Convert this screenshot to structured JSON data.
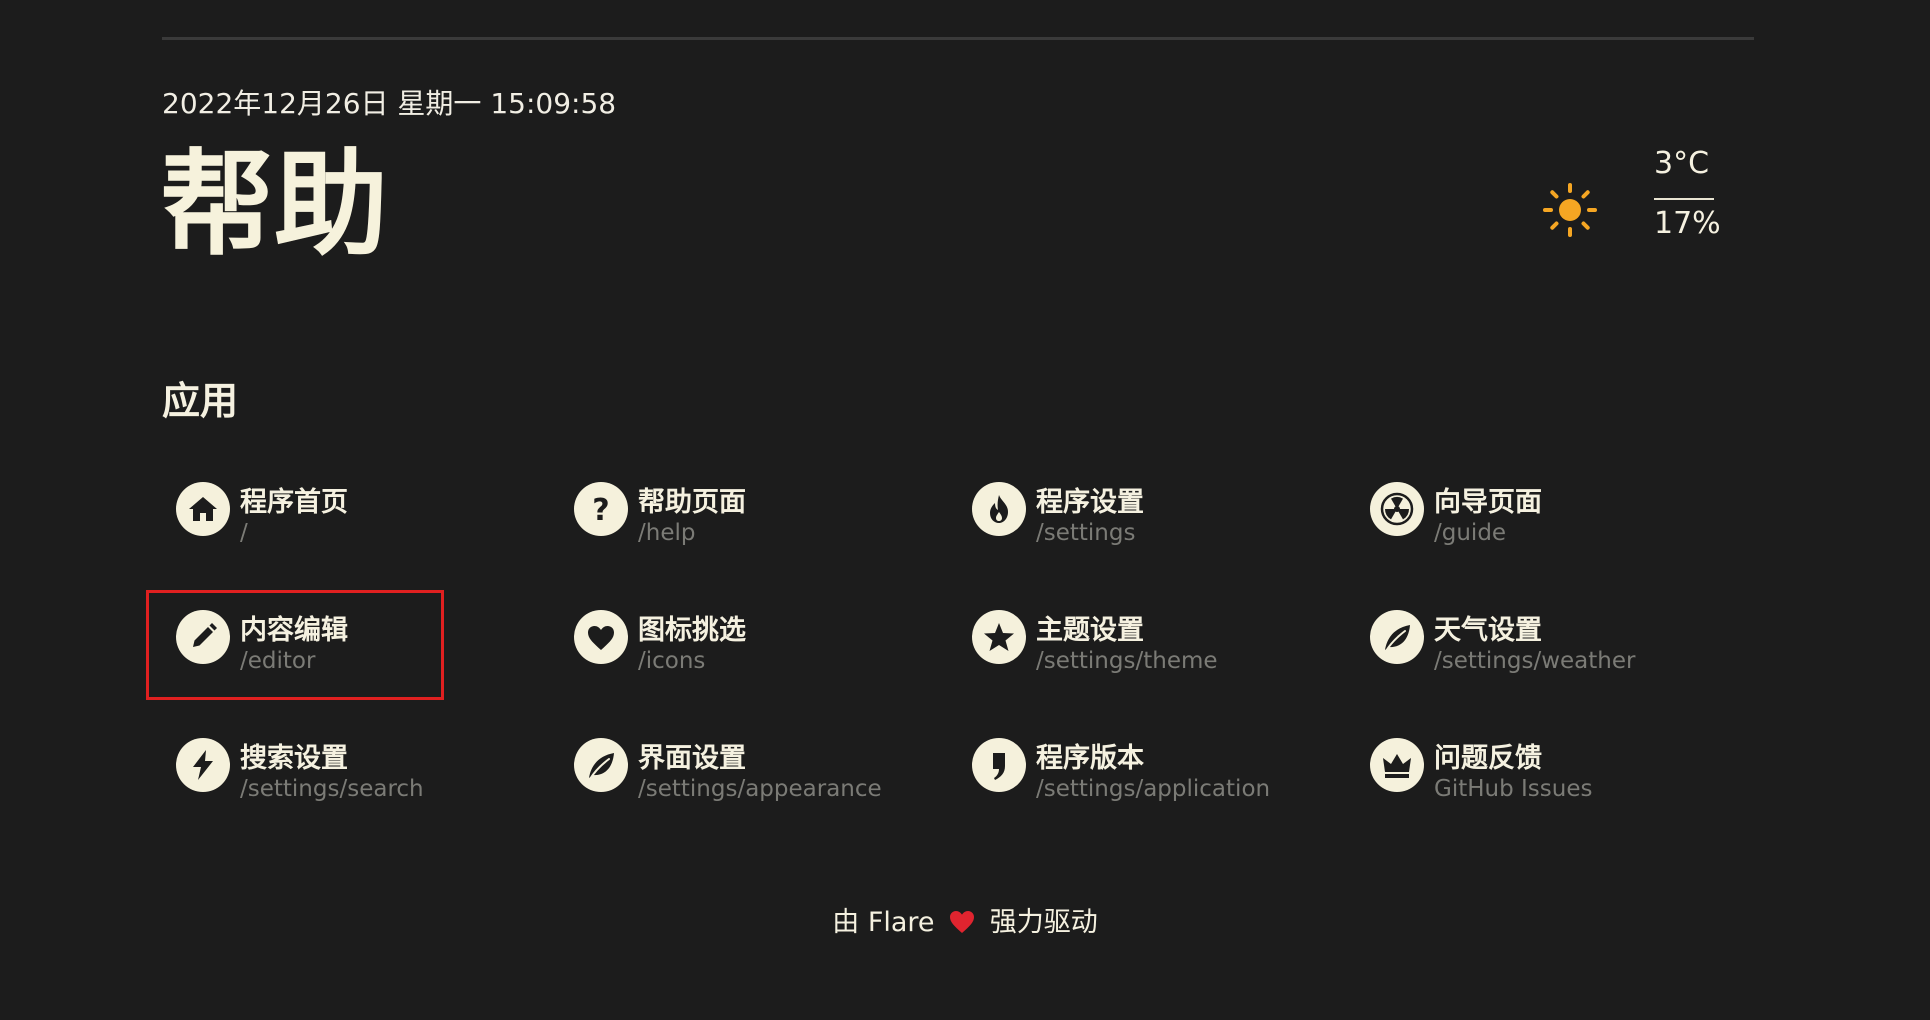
{
  "header": {
    "datetime": "2022年12月26日 星期一 15:09:58",
    "title": "帮助"
  },
  "weather": {
    "icon": "sun-icon",
    "temperature": "3°C",
    "humidity": "17%",
    "icon_color": "#f5a623"
  },
  "section": {
    "title": "应用"
  },
  "apps": [
    {
      "name": "程序首页",
      "path": "/",
      "icon": "home-icon"
    },
    {
      "name": "帮助页面",
      "path": "/help",
      "icon": "help-icon"
    },
    {
      "name": "程序设置",
      "path": "/settings",
      "icon": "flame-icon"
    },
    {
      "name": "向导页面",
      "path": "/guide",
      "icon": "radiation-icon"
    },
    {
      "name": "内容编辑",
      "path": "/editor",
      "icon": "pencil-icon"
    },
    {
      "name": "图标挑选",
      "path": "/icons",
      "icon": "heart-icon"
    },
    {
      "name": "主题设置",
      "path": "/settings/theme",
      "icon": "star-icon"
    },
    {
      "name": "天气设置",
      "path": "/settings/weather",
      "icon": "leaf-icon"
    },
    {
      "name": "搜索设置",
      "path": "/settings/search",
      "icon": "lightning-icon"
    },
    {
      "name": "界面设置",
      "path": "/settings/appearance",
      "icon": "leaf-icon"
    },
    {
      "name": "程序版本",
      "path": "/settings/application",
      "icon": "comma-icon"
    },
    {
      "name": "问题反馈",
      "path": "GitHub Issues",
      "icon": "crown-icon"
    }
  ],
  "footer": {
    "prefix": "由 Flare",
    "suffix": "强力驱动",
    "heart_icon": "heart-icon",
    "heart_color": "#e0242f"
  },
  "colors": {
    "background": "#1c1c1c",
    "text": "#f5f1e0",
    "muted_text": "#7b7b76",
    "icon_bg": "#f5f1dc",
    "highlight": "#e02020"
  }
}
